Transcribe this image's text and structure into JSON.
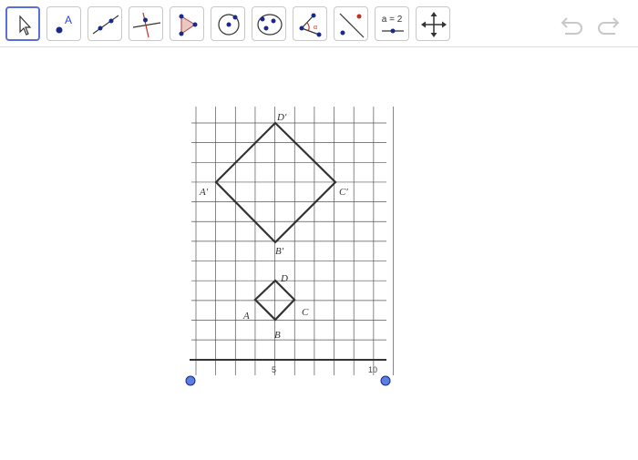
{
  "toolbar": {
    "tools": [
      {
        "name": "move-tool",
        "icon": "cursor-arrow-icon",
        "selected": true
      },
      {
        "name": "point-tool",
        "icon": "point-A-icon"
      },
      {
        "name": "line-tool",
        "icon": "line-through-points-icon"
      },
      {
        "name": "perpendicular-line-tool",
        "icon": "perpendicular-line-icon"
      },
      {
        "name": "polygon-tool",
        "icon": "polygon-icon"
      },
      {
        "name": "circle-tool",
        "icon": "circle-center-point-icon"
      },
      {
        "name": "ellipse-tool",
        "icon": "ellipse-icon"
      },
      {
        "name": "angle-tool",
        "icon": "angle-icon"
      },
      {
        "name": "reflect-tool",
        "icon": "reflect-about-line-icon"
      },
      {
        "name": "slider-tool",
        "icon": "slider-icon",
        "text": "a = 2"
      },
      {
        "name": "move-graphics-view-tool",
        "icon": "move-arrows-icon"
      }
    ],
    "undo_icon": "undo-icon",
    "redo_icon": "redo-icon",
    "accent_color": "#5b6fd6"
  },
  "figure": {
    "labels": {
      "D_prime": "D′",
      "A_prime": "A′",
      "C_prime": "C′",
      "B_prime": "B′",
      "D": "D",
      "A": "A",
      "C": "C",
      "B": "B"
    },
    "axis_ticks": [
      "5",
      "10"
    ],
    "point_color": "#5b7fe0"
  }
}
